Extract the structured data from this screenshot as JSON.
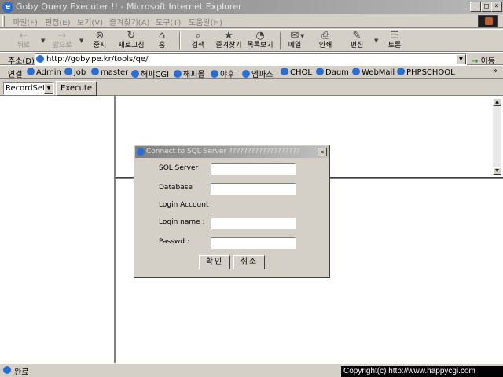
{
  "window": {
    "title": "Goby Query Executer !! - Microsoft Internet Explorer",
    "minimize": "_",
    "maximize": "□",
    "close": "×"
  },
  "menubar": {
    "items": [
      "파일(F)",
      "편집(E)",
      "보기(V)",
      "즐겨찾기(A)",
      "도구(T)",
      "도움말(H)"
    ]
  },
  "toolbar": {
    "back": "뒤로",
    "forward": "앞으로",
    "stop": "중지",
    "refresh": "새로고침",
    "home": "홈",
    "search": "검색",
    "favorites": "즐겨찾기",
    "history": "목록보기",
    "mail": "메일",
    "print": "인쇄",
    "edit": "편집",
    "discuss": "토론"
  },
  "address": {
    "label": "주소(D)",
    "url": "http://goby.pe.kr/tools/qe/",
    "go": "이동"
  },
  "links": {
    "label": "연결",
    "items": [
      "Admin",
      "job",
      "master",
      "해피CGI",
      "해피몰",
      "야후",
      "엠파스",
      "CHOL",
      "Daum",
      "WebMail",
      "PHPSCHOOL"
    ],
    "more": "»"
  },
  "page": {
    "recordset_value": "RecordSet",
    "execute_label": "Execute"
  },
  "dialog": {
    "title": "Connect to SQL Server ???????????????????",
    "close": "×",
    "sql_server_label": "SQL Server",
    "sql_server_value": "",
    "database_label": "Database",
    "database_value": "",
    "login_account_label": "Login Account",
    "login_name_label": "Login name :",
    "login_name_value": "",
    "passwd_label": "Passwd :",
    "passwd_value": "",
    "ok_label": "확인",
    "cancel_label": "취소"
  },
  "status": {
    "text": "완료",
    "copyright": "Copyright(c) http://www.happycgi.com"
  },
  "icons": {
    "app": "ie-icon",
    "back": "back-arrow-icon",
    "forward": "forward-arrow-icon",
    "stop": "stop-icon",
    "refresh": "refresh-icon",
    "home": "home-icon",
    "search": "search-icon",
    "favorites": "favorites-icon",
    "history": "history-icon",
    "mail": "mail-icon",
    "print": "print-icon",
    "edit": "edit-icon",
    "discuss": "discuss-icon"
  }
}
